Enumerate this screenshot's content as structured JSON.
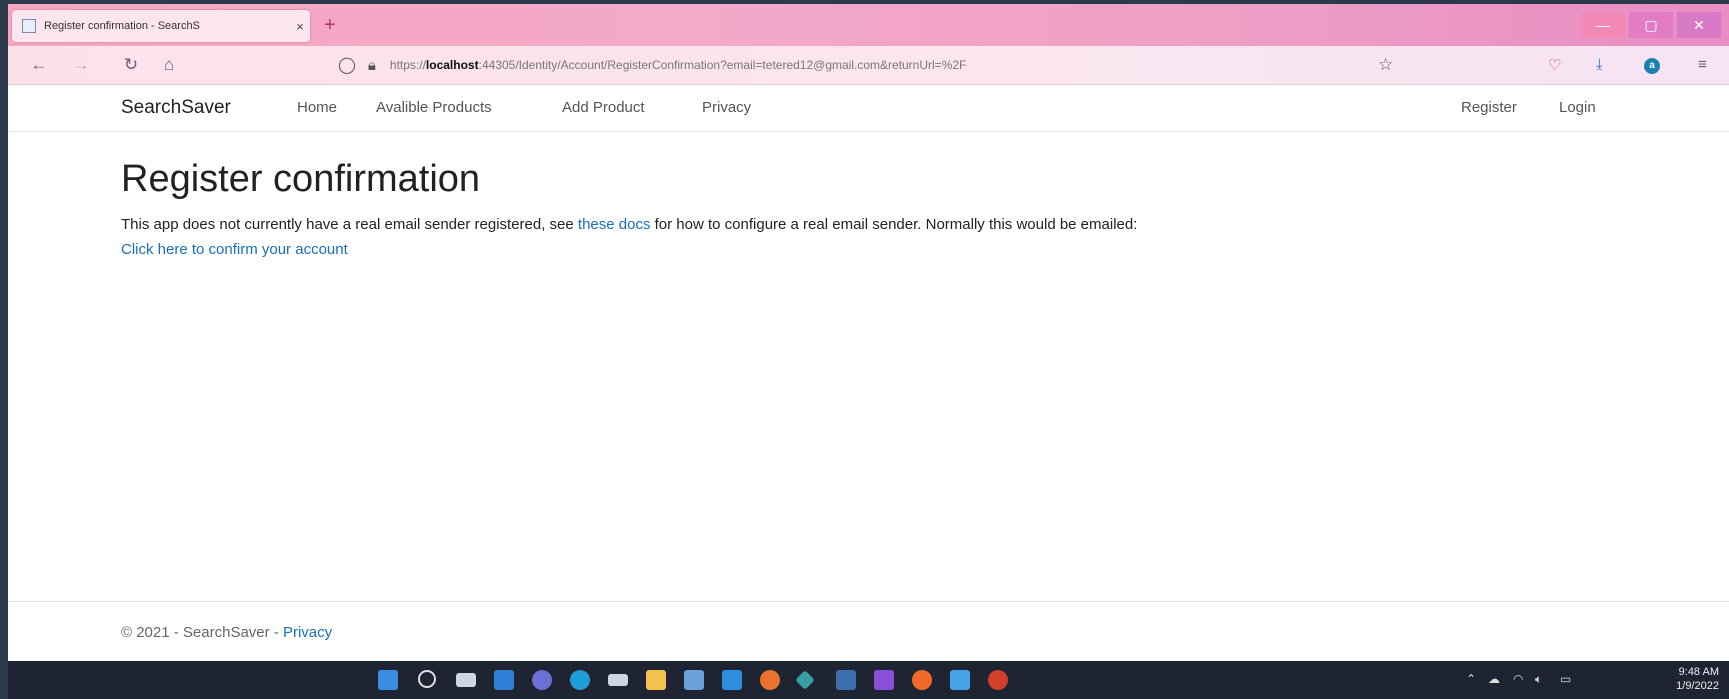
{
  "browser": {
    "tab_title": "Register confirmation - SearchS",
    "tab_close": "×",
    "new_tab": "+",
    "url_scheme": "https://",
    "url_host": "localhost",
    "url_rest": ":44305/Identity/Account/RegisterConfirmation?email=tetered12@gmail.com&returnUrl=%2F",
    "account_initial": "a"
  },
  "site": {
    "brand": "SearchSaver",
    "nav": [
      "Home",
      "Avalible Products",
      "Add Product",
      "Privacy"
    ],
    "auth": [
      "Register",
      "Login"
    ]
  },
  "main": {
    "title": "Register confirmation",
    "text_before": "This app does not currently have a real email sender registered, see ",
    "docs_link": "these docs",
    "text_after": " for how to configure a real email sender. Normally this would be emailed:",
    "confirm_link": "Click here to confirm your account"
  },
  "footer": {
    "text": "© 2021 - SearchSaver - ",
    "privacy": "Privacy"
  },
  "taskbar": {
    "time": "9:48 AM",
    "date": "1/9/2022"
  }
}
